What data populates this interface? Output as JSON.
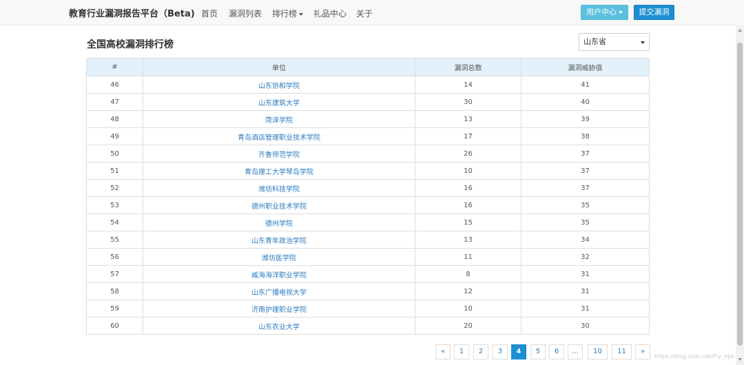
{
  "navbar": {
    "brand": "教育行业漏洞报告平台（Beta)",
    "items": [
      {
        "label": "首页"
      },
      {
        "label": "漏洞列表"
      },
      {
        "label": "排行榜"
      },
      {
        "label": "礼品中心"
      },
      {
        "label": "关于"
      }
    ],
    "user_center_label": "用户中心",
    "submit_label": "提交漏洞"
  },
  "page": {
    "title": "全国高校漏洞排行榜",
    "province_selected": "山东省"
  },
  "table": {
    "headers": [
      "#",
      "单位",
      "漏洞总数",
      "漏洞威胁值"
    ],
    "rows": [
      {
        "rank": "46",
        "school": "山东协和学院",
        "total": "14",
        "threat": "41"
      },
      {
        "rank": "47",
        "school": "山东建筑大学",
        "total": "30",
        "threat": "40"
      },
      {
        "rank": "48",
        "school": "菏泽学院",
        "total": "13",
        "threat": "39"
      },
      {
        "rank": "49",
        "school": "青岛酒店管理职业技术学院",
        "total": "17",
        "threat": "38"
      },
      {
        "rank": "50",
        "school": "齐鲁师范学院",
        "total": "26",
        "threat": "37"
      },
      {
        "rank": "51",
        "school": "青岛理工大学琴岛学院",
        "total": "10",
        "threat": "37"
      },
      {
        "rank": "52",
        "school": "潍坊科技学院",
        "total": "16",
        "threat": "37"
      },
      {
        "rank": "53",
        "school": "德州职业技术学院",
        "total": "16",
        "threat": "35"
      },
      {
        "rank": "54",
        "school": "德州学院",
        "total": "15",
        "threat": "35"
      },
      {
        "rank": "55",
        "school": "山东青年政治学院",
        "total": "13",
        "threat": "34"
      },
      {
        "rank": "56",
        "school": "潍坊医学院",
        "total": "11",
        "threat": "32"
      },
      {
        "rank": "57",
        "school": "威海海洋职业学院",
        "total": "8",
        "threat": "31"
      },
      {
        "rank": "58",
        "school": "山东广播电视大学",
        "total": "12",
        "threat": "31"
      },
      {
        "rank": "59",
        "school": "济南护理职业学院",
        "total": "10",
        "threat": "31"
      },
      {
        "rank": "60",
        "school": "山东农业大学",
        "total": "20",
        "threat": "30"
      }
    ]
  },
  "pagination": {
    "prev": "«",
    "pages": [
      "1",
      "2",
      "3",
      "4",
      "5",
      "6",
      "...",
      "10",
      "11"
    ],
    "current": "4",
    "next": "»"
  },
  "watermark": "https://blog.csdn.net/Fly_hps"
}
